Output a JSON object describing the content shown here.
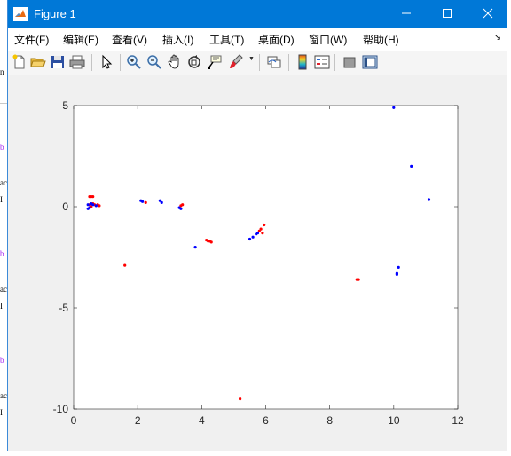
{
  "window": {
    "title": "Figure 1",
    "minimize_label": "—",
    "maximize_label": "☐",
    "close_label": "✕"
  },
  "menu": {
    "items": [
      {
        "label": "文件(F)"
      },
      {
        "label": "编辑(E)"
      },
      {
        "label": "查看(V)"
      },
      {
        "label": "插入(I)"
      },
      {
        "label": "工具(T)"
      },
      {
        "label": "桌面(D)"
      },
      {
        "label": "窗口(W)"
      },
      {
        "label": "帮助(H)"
      }
    ],
    "overflow_icon": "chevron-down-icon"
  },
  "toolbar": {
    "icons": [
      "new-figure-icon",
      "open-file-icon",
      "save-icon",
      "print-icon",
      "pointer-arrow-icon",
      "zoom-in-icon",
      "zoom-out-icon",
      "pan-hand-icon",
      "rotate-3d-icon",
      "data-cursor-icon",
      "brush-icon",
      "link-plot-icon",
      "colorbar-icon",
      "legend-icon",
      "hide-plot-tools-icon",
      "show-plot-tools-icon"
    ]
  },
  "background": {
    "left_chars": [
      "n",
      "b",
      "ac",
      "I",
      "b",
      "ac",
      "I",
      "b",
      "ac",
      "I"
    ]
  },
  "chart_data": {
    "type": "scatter",
    "title": "",
    "xlabel": "",
    "ylabel": "",
    "xlim": [
      0,
      12
    ],
    "ylim": [
      -10,
      5
    ],
    "xticks": [
      "0",
      "2",
      "4",
      "6",
      "8",
      "10",
      "12"
    ],
    "yticks": [
      "5",
      "0",
      "-5",
      "-10"
    ],
    "grid": false,
    "series": [
      {
        "color": "#ff0000",
        "marker": "dot",
        "points": [
          [
            0.5,
            0.5
          ],
          [
            0.55,
            0.5
          ],
          [
            0.6,
            0.5
          ],
          [
            0.5,
            0.1
          ],
          [
            0.6,
            0.15
          ],
          [
            0.65,
            0.1
          ],
          [
            0.75,
            0.1
          ],
          [
            0.8,
            0.05
          ],
          [
            0.55,
            0.0
          ],
          [
            1.6,
            -2.9
          ],
          [
            2.25,
            0.2
          ],
          [
            3.4,
            0.1
          ],
          [
            3.35,
            0.05
          ],
          [
            4.15,
            -1.65
          ],
          [
            4.2,
            -1.7
          ],
          [
            4.25,
            -1.7
          ],
          [
            4.3,
            -1.75
          ],
          [
            5.2,
            -9.5
          ],
          [
            5.85,
            -1.1
          ],
          [
            5.9,
            -1.3
          ],
          [
            5.95,
            -0.9
          ],
          [
            5.8,
            -1.2
          ],
          [
            8.85,
            -3.6
          ],
          [
            8.9,
            -3.6
          ]
        ]
      },
      {
        "color": "#0000ff",
        "marker": "dot",
        "points": [
          [
            0.45,
            0.1
          ],
          [
            0.5,
            -0.05
          ],
          [
            0.55,
            0.15
          ],
          [
            0.45,
            -0.1
          ],
          [
            0.6,
            0.1
          ],
          [
            0.7,
            0.05
          ],
          [
            2.1,
            0.3
          ],
          [
            2.15,
            0.25
          ],
          [
            2.7,
            0.3
          ],
          [
            2.75,
            0.2
          ],
          [
            3.3,
            -0.05
          ],
          [
            3.35,
            -0.1
          ],
          [
            3.8,
            -2.0
          ],
          [
            5.5,
            -1.6
          ],
          [
            5.6,
            -1.5
          ],
          [
            5.7,
            -1.35
          ],
          [
            5.75,
            -1.3
          ],
          [
            10.0,
            4.9
          ],
          [
            10.1,
            -3.3
          ],
          [
            10.15,
            -3.0
          ],
          [
            10.1,
            -3.35
          ],
          [
            10.55,
            2.0
          ],
          [
            11.1,
            0.35
          ]
        ]
      }
    ]
  }
}
